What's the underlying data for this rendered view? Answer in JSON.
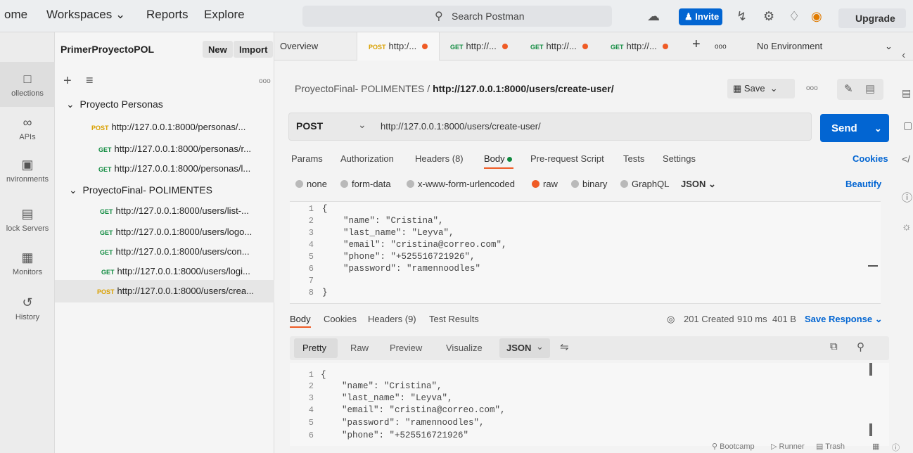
{
  "topbar": {
    "home": "ome",
    "workspaces": "Workspaces ⌄",
    "reports": "Reports",
    "explore": "Explore",
    "search_placeholder": "Search Postman",
    "invite": "Invite",
    "upgrade": "Upgrade"
  },
  "rail": [
    {
      "label": "ollections",
      "icon": "collections-icon"
    },
    {
      "label": "APIs",
      "icon": "apis-icon"
    },
    {
      "label": "nvironments",
      "icon": "environments-icon"
    },
    {
      "label": "lock Servers",
      "icon": "mock-servers-icon"
    },
    {
      "label": "Monitors",
      "icon": "monitors-icon"
    },
    {
      "label": "History",
      "icon": "history-icon"
    }
  ],
  "sidebar": {
    "workspace": "PrimerProyectoPOL",
    "new": "New",
    "import": "Import",
    "folders": [
      "Proyecto Personas",
      "ProyectoFinal- POLIMENTES"
    ],
    "requests": [
      {
        "method": "POST",
        "url": "http://127.0.0.1:8000/personas/..."
      },
      {
        "method": "GET",
        "url": "http://127.0.0.1:8000/personas/r..."
      },
      {
        "method": "GET",
        "url": "http://127.0.0.1:8000/personas/l..."
      },
      {
        "method": "GET",
        "url": "http://127.0.0.1:8000/users/list-..."
      },
      {
        "method": "GET",
        "url": "http://127.0.0.1:8000/users/logo..."
      },
      {
        "method": "GET",
        "url": "http://127.0.0.1:8000/users/con..."
      },
      {
        "method": "GET",
        "url": "http://127.0.0.1:8000/users/logi..."
      },
      {
        "method": "POST",
        "url": "http://127.0.0.1:8000/users/crea..."
      }
    ]
  },
  "tabs": {
    "overview": "Overview",
    "items": [
      {
        "method": "POST",
        "label": "http:/..."
      },
      {
        "method": "GET",
        "label": "http://..."
      },
      {
        "method": "GET",
        "label": "http://..."
      },
      {
        "method": "GET",
        "label": "http://..."
      }
    ],
    "more": "ooo",
    "environment": "No Environment"
  },
  "request": {
    "breadcrumb_collection": "ProyectoFinal- POLIMENTES",
    "breadcrumb_sep": "/",
    "breadcrumb_request": "http://127.0.0.1:8000/users/create-user/",
    "save": "Save",
    "method": "POST",
    "url": "http://127.0.0.1:8000/users/create-user/",
    "send": "Send",
    "subtabs": [
      "Params",
      "Authorization",
      "Headers (8)",
      "Body",
      "Pre-request Script",
      "Tests",
      "Settings"
    ],
    "cookies": "Cookies",
    "body_types": [
      "none",
      "form-data",
      "x-www-form-urlencoded",
      "raw",
      "binary",
      "GraphQL"
    ],
    "format": "JSON",
    "beautify": "Beautify",
    "body_lines": [
      "{",
      "    \"name\": \"Cristina\",",
      "    \"last_name\": \"Leyva\",",
      "    \"email\": \"cristina@correo.com\",",
      "    \"phone\": \"+525516721926\",",
      "    \"password\": \"ramennoodles\"",
      "",
      "}"
    ]
  },
  "response": {
    "tabs": [
      "Body",
      "Cookies",
      "Headers (9)",
      "Test Results"
    ],
    "status": "201 Created",
    "time": "910 ms",
    "size": "401 B",
    "save_response": "Save Response",
    "views": [
      "Pretty",
      "Raw",
      "Preview",
      "Visualize"
    ],
    "format": "JSON",
    "body_lines": [
      "{",
      "    \"name\": \"Cristina\",",
      "    \"last_name\": \"Leyva\",",
      "    \"email\": \"cristina@correo.com\",",
      "    \"password\": \"ramennoodles\",",
      "    \"phone\": \"+525516721926\""
    ]
  },
  "footer": {
    "bootcamp": "Bootcamp",
    "runner": "Runner",
    "trash": "Trash"
  },
  "colors": {
    "send_blue": "#0265d2",
    "get_green": "#0f8a3f",
    "post_orange": "#d9a000",
    "body_dot": "#0f8a3f",
    "raw_dot": "#ef5b25"
  }
}
